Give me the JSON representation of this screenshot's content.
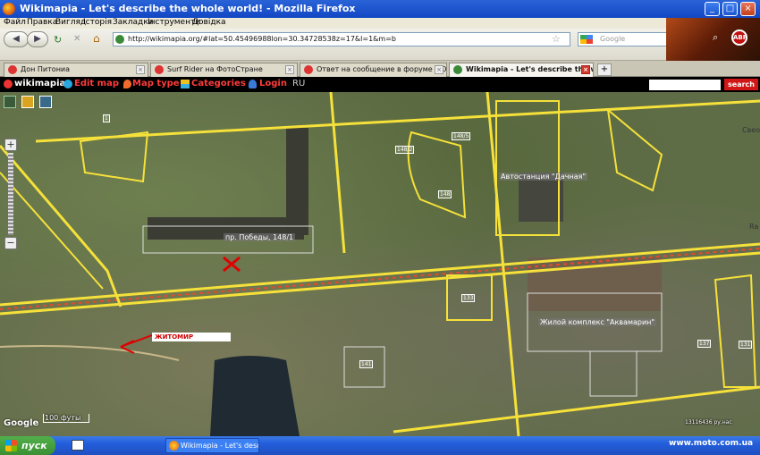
{
  "window": {
    "title": "Wikimapia - Let's describe the whole world! - Mozilla Firefox"
  },
  "menu": [
    "Файл",
    "Правка",
    "Вигляд",
    "Історія",
    "Закладки",
    "Інструменти",
    "Довідка"
  ],
  "navbar": {
    "url": "http://wikimapia.org/#lat=50.45496988lon=30.34728538z=17&l=1&m=b",
    "search_placeholder": "Google",
    "adblock_label": "ABP"
  },
  "tabs": [
    {
      "label": "Дон Питониа",
      "active": false
    },
    {
      "label": "Surf Rider на ФотоСтране",
      "active": false
    },
    {
      "label": "Ответ на сообщение в форуме МОТО",
      "active": false
    },
    {
      "label": "Wikimapia - Let's describe the w...",
      "active": true
    }
  ],
  "wikimapia": {
    "logo": "wikimapia",
    "edit_map": "Edit map",
    "map_type": "Map type",
    "categories": "Categories",
    "login": "Login",
    "language": "RU",
    "search_button": "search"
  },
  "map": {
    "labels": {
      "street": "пр. Победы, 148/1",
      "bus_station": "Автостанция \"Дачная\"",
      "complex": "Жилой комплекс \"Аквамарин\"",
      "zhitomir": "ЖИТОМИР",
      "scale": "100 футы",
      "coords": "13116436 ру.нас",
      "corner_right": "Свео",
      "ra": "Ra"
    },
    "house_numbers": [
      "148/2",
      "148",
      "1",
      "148/5",
      "133",
      "137",
      "141",
      "131"
    ]
  },
  "taskbar": {
    "start": "пуск",
    "items": [
      "Wikimapia - Let's desc..."
    ]
  },
  "watermark": "www.moto.com.ua",
  "colors": {
    "road": "#f5e13a",
    "accent": "#ff3b3b",
    "marker": "#e00000"
  }
}
